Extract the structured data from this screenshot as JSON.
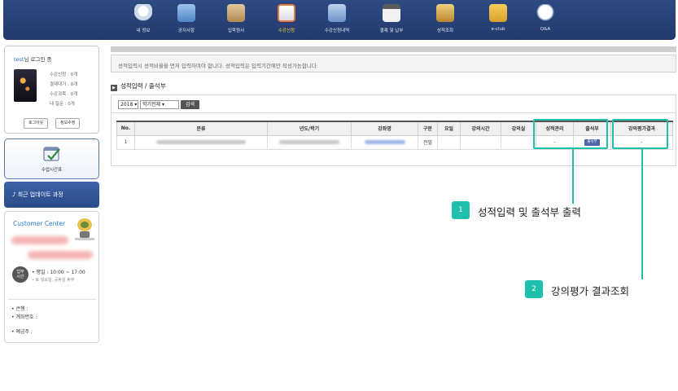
{
  "nav": {
    "items": [
      {
        "label": "내 정보",
        "icon": "user-icon",
        "color": "#e8eef6",
        "active": false
      },
      {
        "label": "공지사항",
        "icon": "notice-icon",
        "color": "#6fa8dc",
        "active": false
      },
      {
        "label": "입학원서",
        "icon": "application-icon",
        "color": "#c9a36a",
        "active": false
      },
      {
        "label": "수강신청",
        "icon": "registration-icon",
        "color": "#f0f0f0",
        "active": true
      },
      {
        "label": "수강신청내역",
        "icon": "history-icon",
        "color": "#8fb3e0",
        "active": false
      },
      {
        "label": "결제 및 납부",
        "icon": "calendar-icon",
        "color": "#e6e6e6",
        "active": false
      },
      {
        "label": "성적조회",
        "icon": "grade-icon",
        "color": "#d4a84a",
        "active": false
      },
      {
        "label": "e-club",
        "icon": "folder-icon",
        "color": "#e8b640",
        "active": false
      },
      {
        "label": "Q&A",
        "icon": "chat-icon",
        "color": "#f2f2f2",
        "active": false
      }
    ]
  },
  "login": {
    "user": "test",
    "title_suffix": "님 로그인 중",
    "stats": [
      "수강신청 : 0개",
      "결제대기 : 0개",
      "수강과목 : 0개",
      "내 질문 : 0개"
    ],
    "logout_label": "로그아웃",
    "edit_label": "정보수정"
  },
  "schedule": {
    "label": "수업시간표"
  },
  "recent": {
    "label": "최근 업데이트 과정"
  },
  "customer_center": {
    "title": "Customer Center",
    "hours_badge": "업무\n시간",
    "hours": "• 평일 : 10:00 ~ 17:00",
    "closed": "• 토 일요일, 공휴일 휴무",
    "bank_label": "• 은행 :",
    "account_label": "• 계좌번호 :",
    "holder_label": "• 예금주 :"
  },
  "notice": {
    "text": "성적입력시 성적비율을 먼저 입력하여야 합니다. 성적입력은 입력기간에만 작성가능합니다."
  },
  "section": {
    "title": "성적입력 / 출석부"
  },
  "filters": {
    "year": "2018",
    "term": "학기전체",
    "search_label": "검색"
  },
  "table": {
    "headers": [
      "No.",
      "분류",
      "년도/학기",
      "강좌명",
      "구분",
      "요일",
      "강의시간",
      "강의실",
      "성적관리",
      "출석부",
      "강의평가결과"
    ],
    "rows": [
      {
        "no": "1",
        "category": "",
        "year_term": "",
        "course": "",
        "type": "전필",
        "day": "",
        "time": "",
        "room": "",
        "grade": "-",
        "attendance_label": "출석부",
        "evaluation": "-"
      }
    ]
  },
  "callouts": [
    {
      "num": "1",
      "text": "성적입력 및 출석부 출력"
    },
    {
      "num": "2",
      "text": "강의평가 결과조회"
    }
  ],
  "colors": {
    "nav": "#2b4679",
    "highlight": "#1fbfae",
    "accent": "#2e6bbf"
  }
}
